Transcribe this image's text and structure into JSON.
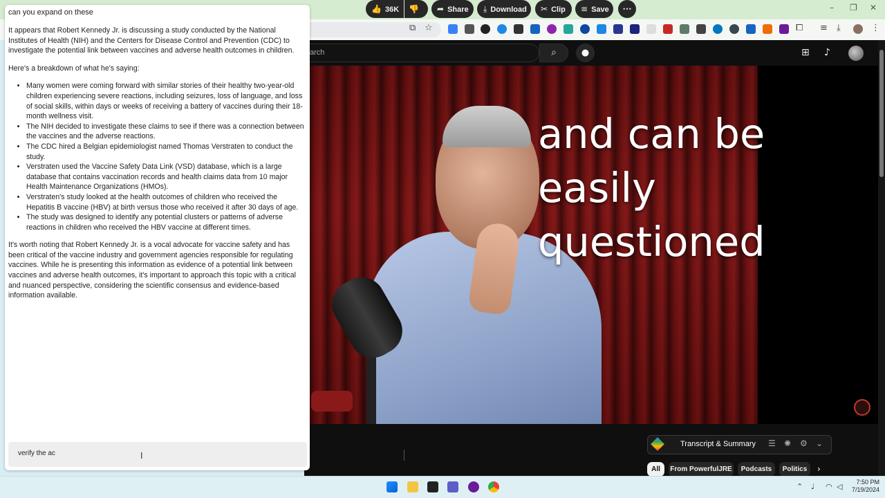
{
  "browser": {
    "win_min": "–",
    "win_restore": "❐",
    "win_close": "✕"
  },
  "youtube": {
    "search_placeholder": "arch",
    "video_caption_line1": "and can be easily",
    "video_caption_line2": "questioned",
    "actions": {
      "likes": "36K",
      "share": "Share",
      "download": "Download",
      "clip": "Clip",
      "save": "Save"
    },
    "transcript_label": "Transcript & Summary",
    "chips": [
      "All",
      "From PowerfulJRE",
      "Podcasts",
      "Politics"
    ]
  },
  "chat": {
    "question": "can you expand on these",
    "intro": "It appears that Robert Kennedy Jr. is discussing a study conducted by the National Institutes of Health (NIH) and the Centers for Disease Control and Prevention (CDC) to investigate the potential link between vaccines and adverse health outcomes in children.",
    "breakdown_heading": "Here's a breakdown of what he's saying:",
    "bullets": [
      "Many women were coming forward with similar stories of their healthy two-year-old children experiencing severe reactions, including seizures, loss of language, and loss of social skills, within days or weeks of receiving a battery of vaccines during their 18-month wellness visit.",
      "The NIH decided to investigate these claims to see if there was a connection between the vaccines and the adverse reactions.",
      "The CDC hired a Belgian epidemiologist named Thomas Verstraten to conduct the study.",
      "Verstraten used the Vaccine Safety Data Link (VSD) database, which is a large database that contains vaccination records and health claims data from 10 major Health Maintenance Organizations (HMOs).",
      "Verstraten's study looked at the health outcomes of children who received the Hepatitis B vaccine (HBV) at birth versus those who received it after 30 days of age.",
      "The study was designed to identify any potential clusters or patterns of adverse reactions in children who received the HBV vaccine at different times."
    ],
    "conclusion": "It's worth noting that Robert Kennedy Jr. is a vocal advocate for vaccine safety and has been critical of the vaccine industry and government agencies responsible for regulating vaccines. While he is presenting this information as evidence of a potential link between vaccines and adverse health outcomes, it's important to approach this topic with a critical and nuanced perspective, considering the scientific consensus and evidence-based information available.",
    "input_value": "verify the ac"
  },
  "taskbar": {
    "time": "7:50 PM",
    "date": "7/19/2024"
  },
  "icons": {
    "search": "search-icon",
    "mic": "mic-icon",
    "like": "thumbs-up-icon",
    "dislike": "thumbs-down-icon",
    "share": "share-icon",
    "download": "download-icon",
    "clip": "scissors-icon",
    "save": "playlist-add-icon",
    "more": "more-icon"
  }
}
